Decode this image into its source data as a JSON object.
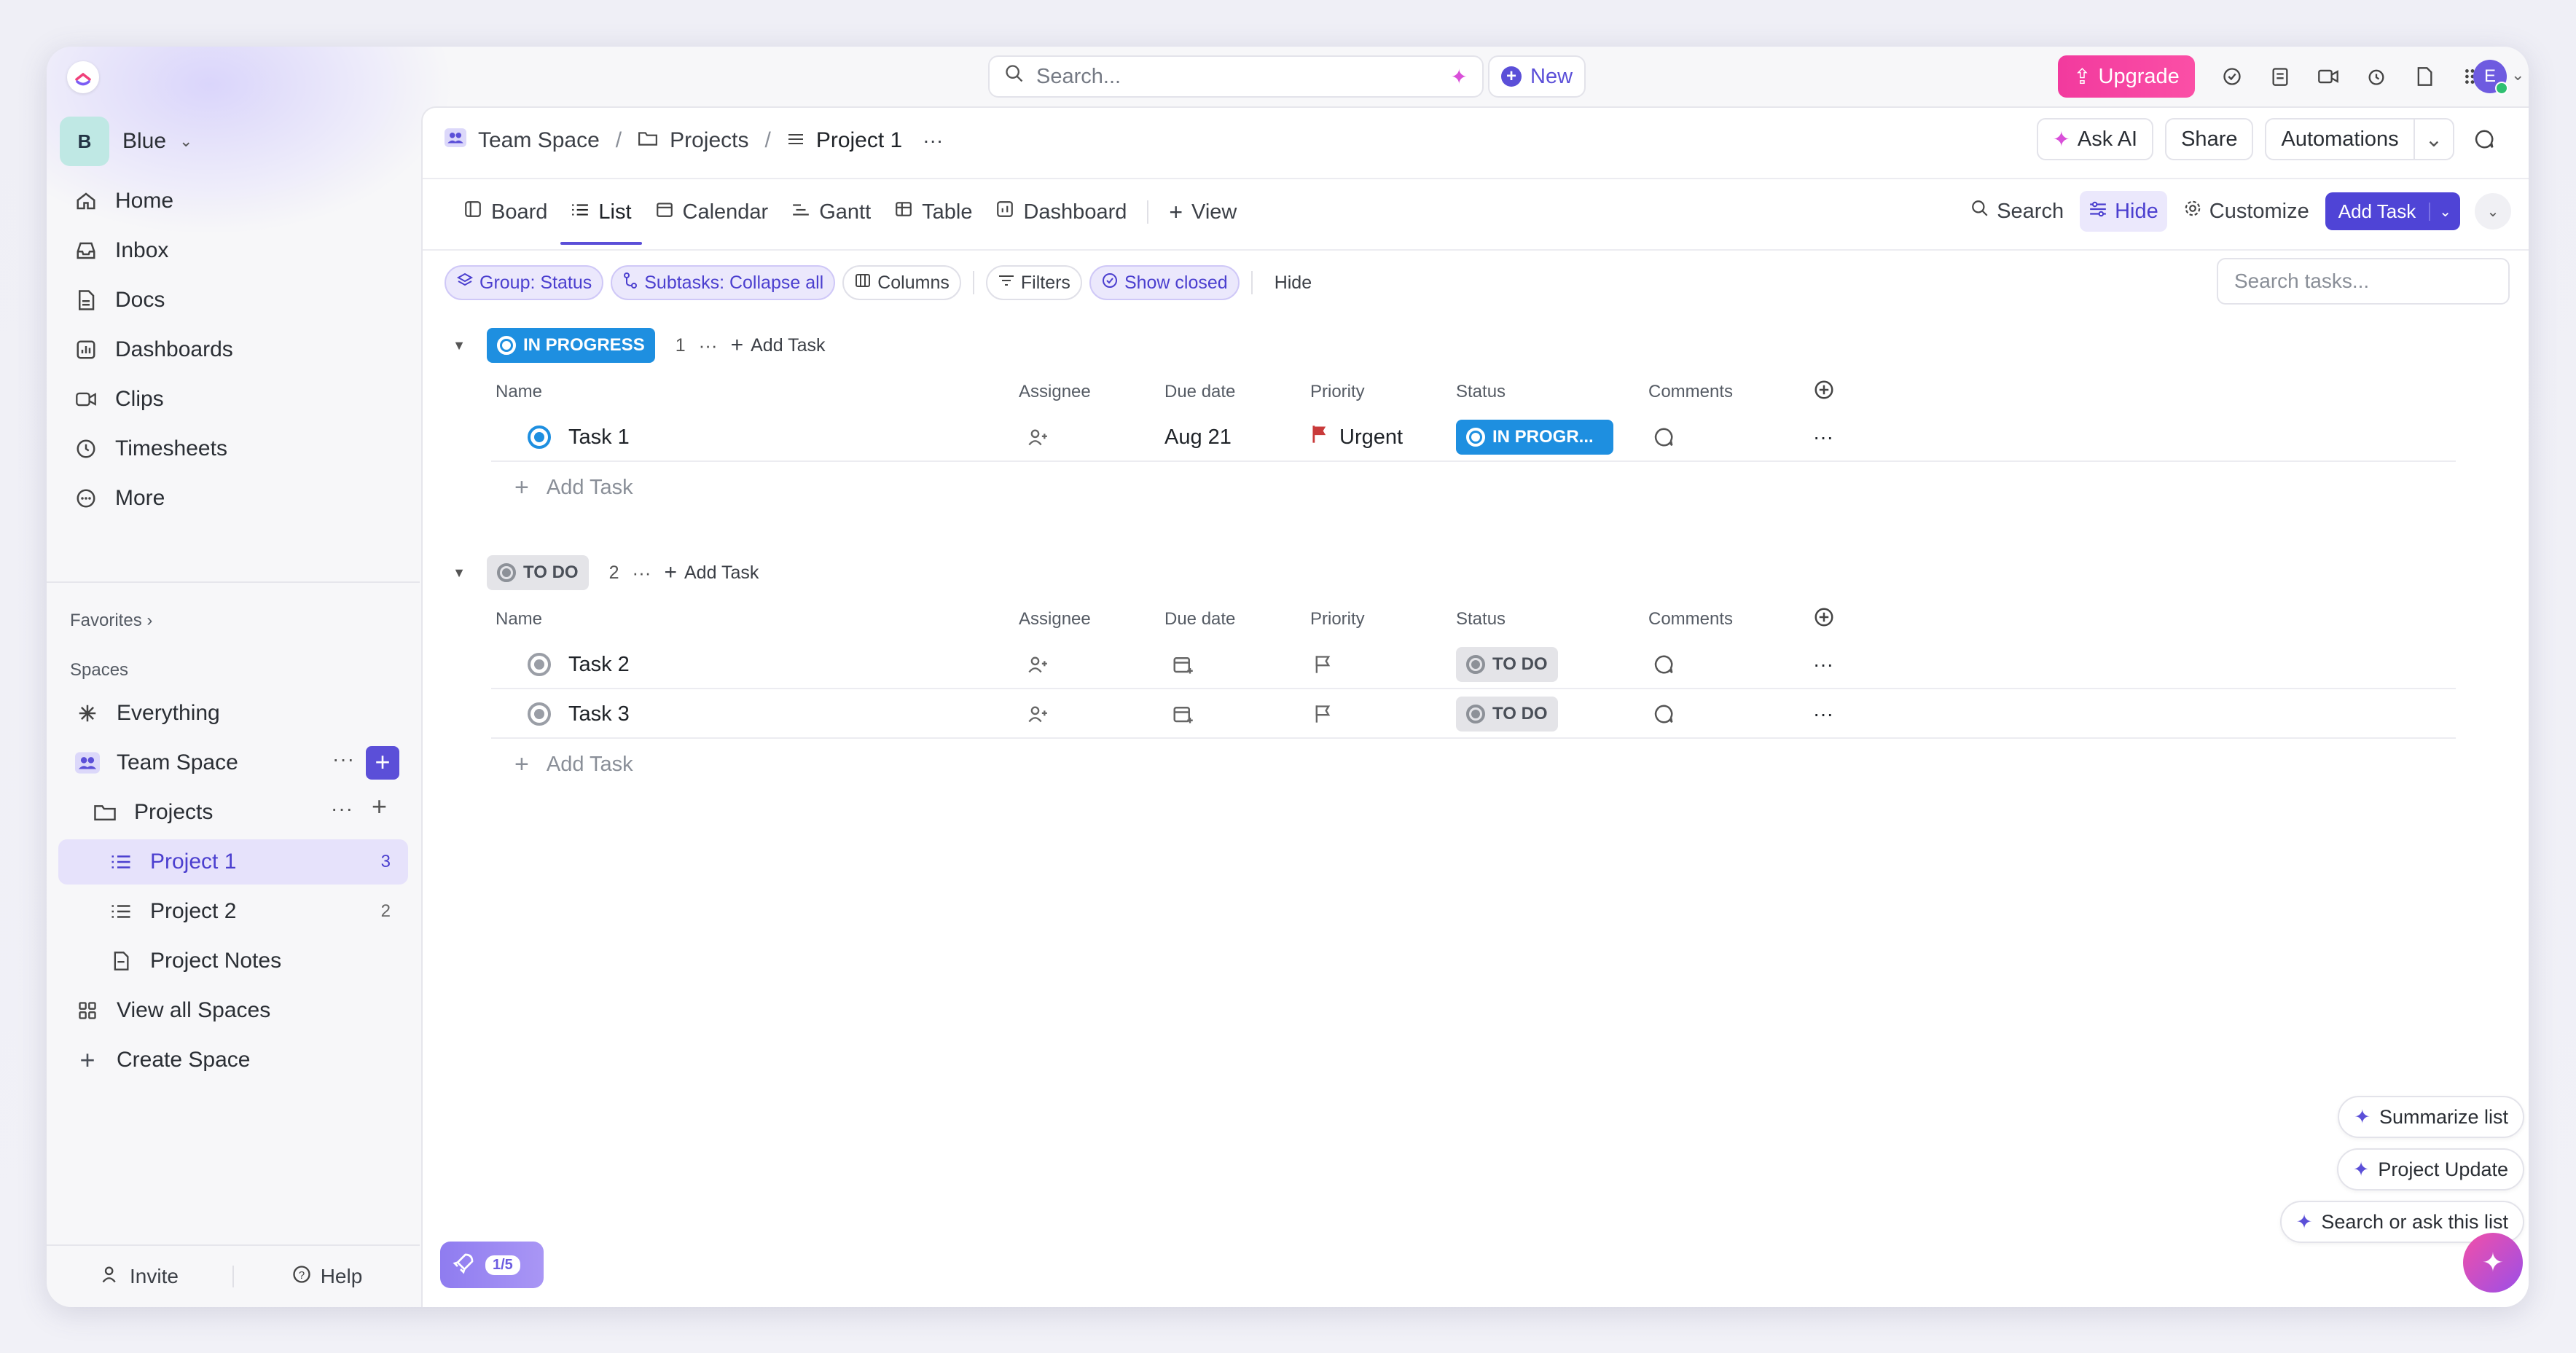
{
  "topbar": {
    "search_placeholder": "Search...",
    "new_label": "New",
    "upgrade_label": "Upgrade",
    "avatar_initial": "E"
  },
  "sidebar": {
    "workspace": {
      "badge": "B",
      "name": "Blue"
    },
    "nav": [
      {
        "label": "Home",
        "icon": "home-icon"
      },
      {
        "label": "Inbox",
        "icon": "inbox-icon"
      },
      {
        "label": "Docs",
        "icon": "docs-icon"
      },
      {
        "label": "Dashboards",
        "icon": "dashboards-icon"
      },
      {
        "label": "Clips",
        "icon": "clips-icon"
      },
      {
        "label": "Timesheets",
        "icon": "timesheets-icon"
      },
      {
        "label": "More",
        "icon": "more-icon"
      }
    ],
    "favorites_label": "Favorites",
    "spaces_label": "Spaces",
    "spaces": {
      "everything": "Everything",
      "team_space": "Team Space",
      "projects": "Projects",
      "project1": {
        "label": "Project 1",
        "count": "3"
      },
      "project2": {
        "label": "Project 2",
        "count": "2"
      },
      "project_notes": "Project Notes",
      "view_all": "View all Spaces",
      "create": "Create Space"
    },
    "bottom": {
      "invite": "Invite",
      "help": "Help"
    }
  },
  "header": {
    "breadcrumb": [
      "Team Space",
      "Projects",
      "Project 1"
    ],
    "ask_ai": "Ask AI",
    "share": "Share",
    "automations": "Automations"
  },
  "tabs": [
    "Board",
    "List",
    "Calendar",
    "Gantt",
    "Table",
    "Dashboard"
  ],
  "add_view": "View",
  "tabs_right": {
    "search": "Search",
    "hide": "Hide",
    "customize": "Customize",
    "add_task": "Add Task"
  },
  "chips": {
    "group": "Group: Status",
    "subtasks": "Subtasks: Collapse all",
    "columns": "Columns",
    "filters": "Filters",
    "show_closed": "Show closed",
    "hide": "Hide"
  },
  "task_search_placeholder": "Search tasks...",
  "columns": [
    "Name",
    "Assignee",
    "Due date",
    "Priority",
    "Status",
    "Comments"
  ],
  "groups": [
    {
      "status": "IN PROGRESS",
      "count": "1",
      "add_task": "Add Task",
      "tasks": [
        {
          "name": "Task 1",
          "due": "Aug 21",
          "priority": "Urgent",
          "status": "IN PROGR..."
        }
      ]
    },
    {
      "status": "TO DO",
      "count": "2",
      "add_task": "Add Task",
      "tasks": [
        {
          "name": "Task 2",
          "status": "TO DO"
        },
        {
          "name": "Task 3",
          "status": "TO DO"
        }
      ]
    }
  ],
  "add_task_row": "Add Task",
  "ai_actions": [
    "Summarize list",
    "Project Update",
    "Search or ask this list"
  ],
  "launch_progress": "1/5",
  "colors": {
    "accent": "#5b4fd8",
    "in_progress": "#1e8fe0",
    "urgent": "#c93a3a",
    "upgrade": "#f23a9e"
  }
}
